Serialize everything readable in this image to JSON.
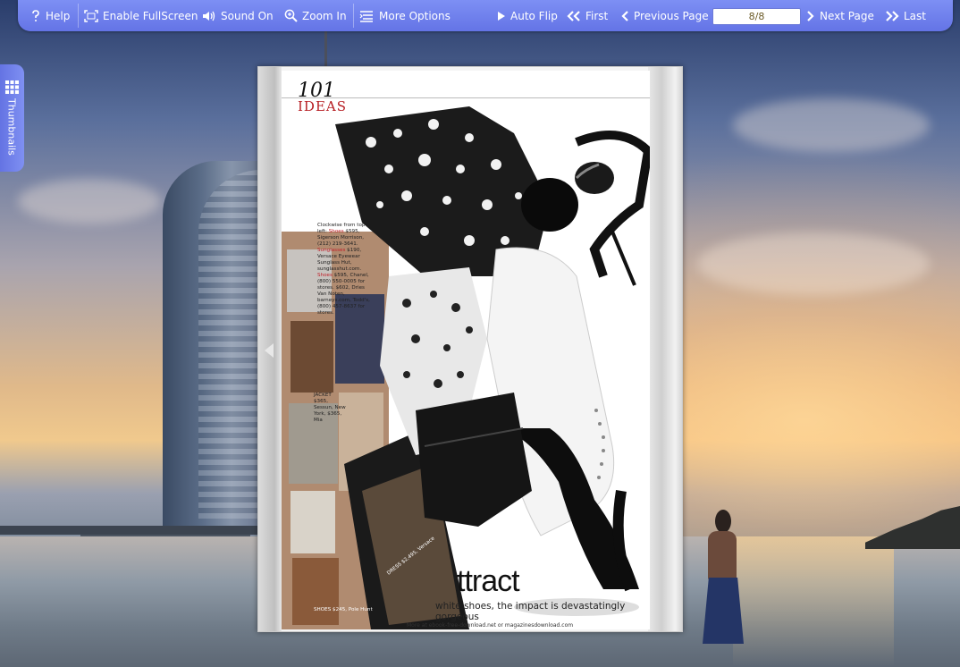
{
  "toolbar": {
    "help": "Help",
    "fullscreen": "Enable FullScreen",
    "sound": "Sound On",
    "zoom": "Zoom In",
    "more": "More Options",
    "autoflip": "Auto Flip",
    "first": "First",
    "previous": "Previous Page",
    "page_indicator": "8/8",
    "next": "Next Page",
    "last": "Last"
  },
  "sidebar": {
    "thumbnails": "Thumbnails"
  },
  "magazine": {
    "masthead_number": "101",
    "masthead_word": "IDEAS",
    "caption_intro": "Clockwise from top left:",
    "caption_shoes_label": "Shoes",
    "caption_text_a": "$595, Sigerson Morrison, (212) 219-3641.",
    "caption_sunglasses_label": "Sunglasses",
    "caption_text_b": "$190, Versace Eyewear Sunglass Hut, sunglasshut.com.",
    "caption_shoes_label_2": "Shoes",
    "caption_text_c": "$595, Chanel, (800) 550-0005 for stores. $602, Dries Van Noten, barneys.com, Todd's, (800) 457-8637 for stores.",
    "jacket_caption": "JACKET $365, Sessun, New York, $365, Mia",
    "dress_caption": "DRESS $2,495, Versace",
    "shoes_caption": "SHOES $245, Pole Hunt",
    "headline": "ttract",
    "subhead": "white shoes, the impact is devastatingly gorgeous",
    "footer": "More at ebook-free-download.net or magazinesdownload.com"
  }
}
